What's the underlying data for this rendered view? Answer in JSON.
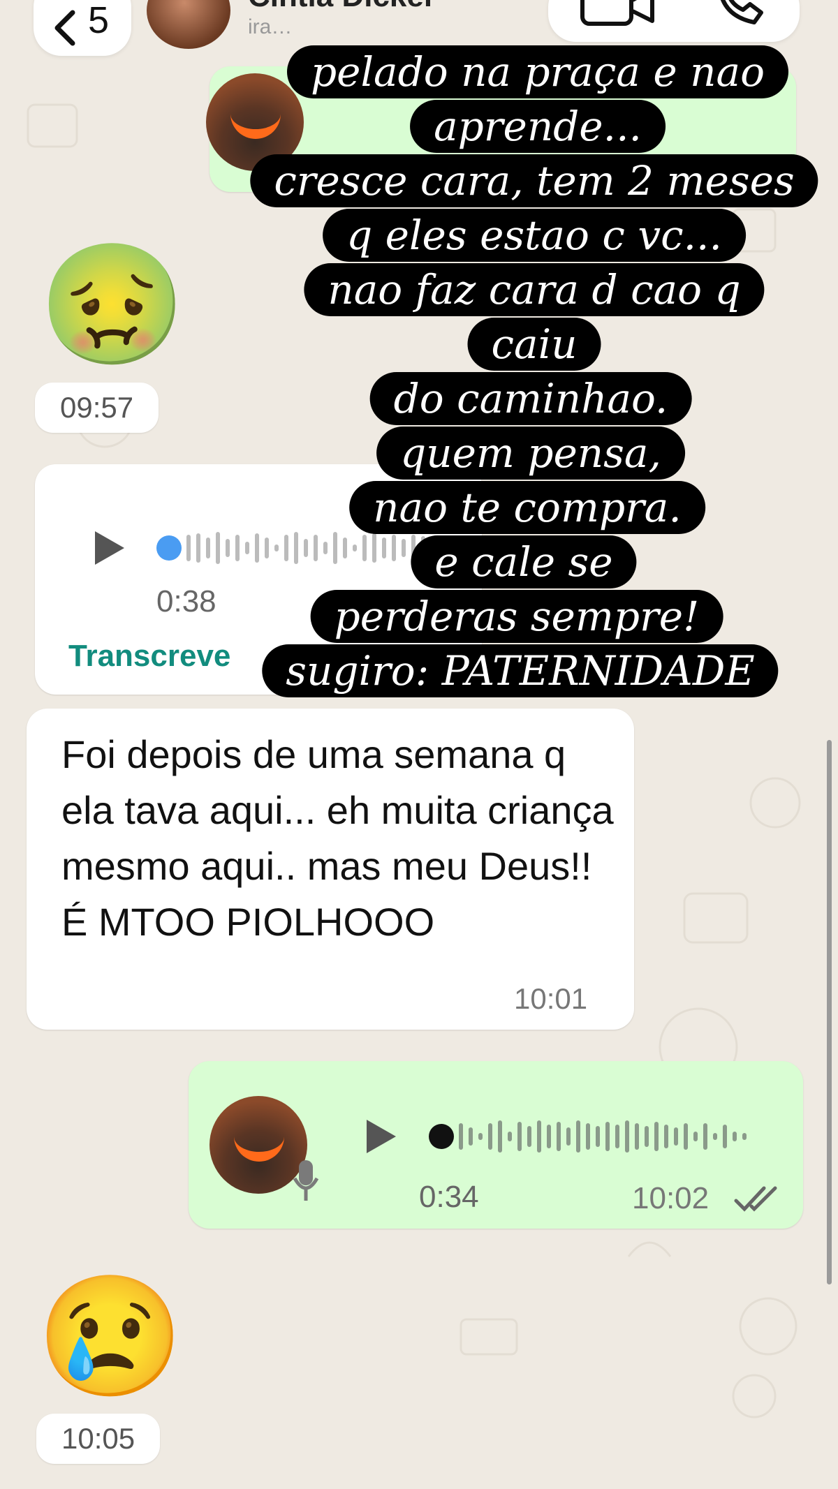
{
  "header": {
    "back_count": "5",
    "contact_name": "Cintia Dicker",
    "contact_status": "ira…"
  },
  "messages": {
    "emoji_1": "🤢",
    "time_1": "09:57",
    "voice_in": {
      "duration": "0:38",
      "transcribe_label": "Transcreve",
      "progress": 0.0
    },
    "text_in": {
      "text": "Foi depois de uma semana q ela tava aqui... eh muita criança mesmo aqui.. mas meu Deus!! É MTOO PIOLHOOO",
      "time": "10:01"
    },
    "voice_out": {
      "duration": "0:34",
      "time": "10:02",
      "progress": 0.0
    },
    "emoji_2": "😢",
    "time_2": "10:05"
  },
  "overlay_lines": [
    "pelado na praça e nao",
    "aprende...",
    "cresce cara, tem 2 meses",
    "q eles estao c vc...",
    "nao faz cara d cao q",
    "caiu",
    "do caminhao.",
    "quem pensa,",
    "nao te compra.",
    "e cale se",
    "perderas sempre!",
    "sugiro: PATERNIDADE"
  ],
  "colors": {
    "background": "#efeae2",
    "outgoing_bubble": "#d9fdd3",
    "incoming_bubble": "#ffffff",
    "accent_green": "#128c7e",
    "unplayed_dot": "#4a9cf2"
  }
}
